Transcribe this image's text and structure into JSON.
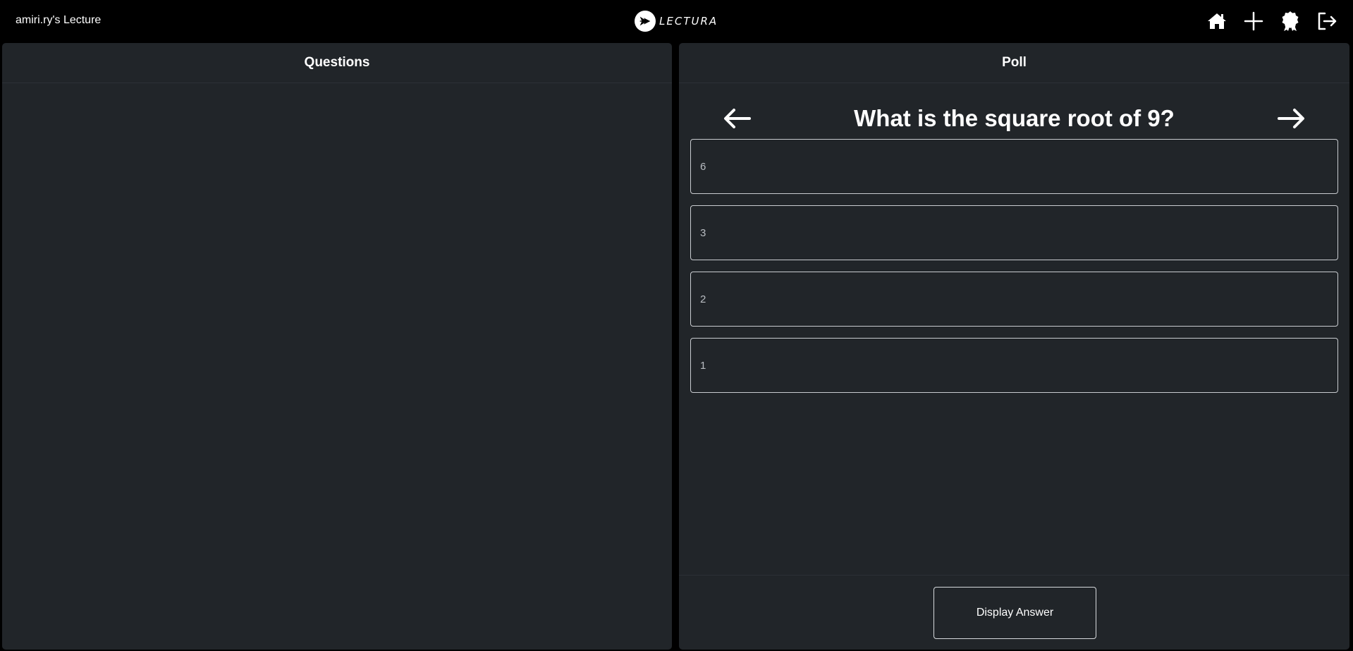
{
  "header": {
    "lecture_title": "amiri.ry's Lecture",
    "brand_name": "LECTURA",
    "icons": [
      "home-icon",
      "plus-icon",
      "badge-icon",
      "logout-icon"
    ]
  },
  "questions_panel": {
    "title": "Questions"
  },
  "poll_panel": {
    "title": "Poll",
    "question": "What is the square root of 9?",
    "options": [
      {
        "label": "6"
      },
      {
        "label": "3"
      },
      {
        "label": "2"
      },
      {
        "label": "1"
      }
    ],
    "display_answer_label": "Display Answer"
  },
  "colors": {
    "background": "#000000",
    "panel": "#212529",
    "text": "#ffffff",
    "option_text": "#b9bdc2",
    "option_border": "#c9ccd0"
  }
}
